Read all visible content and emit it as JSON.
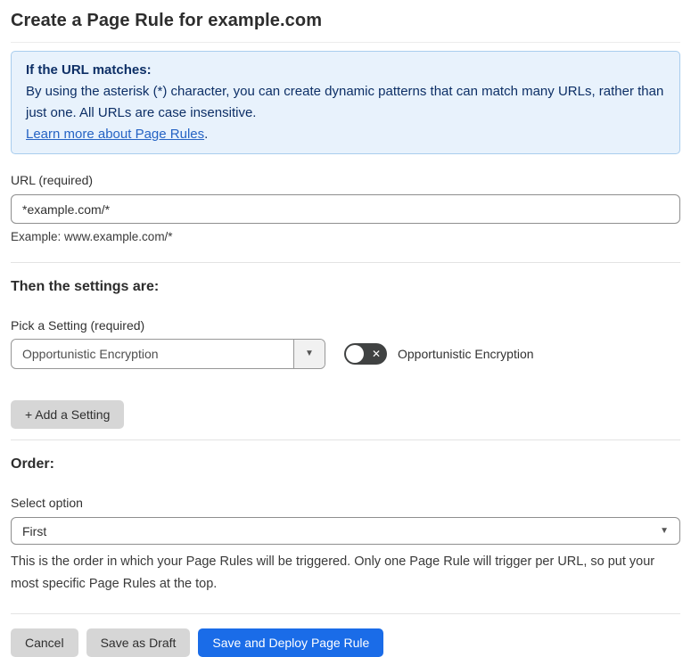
{
  "page": {
    "title": "Create a Page Rule for example.com"
  },
  "info_box": {
    "heading": "If the URL matches:",
    "body": "By using the asterisk (*) character, you can create dynamic patterns that can match many URLs, rather than just one. All URLs are case insensitive.",
    "link_label": "Learn more about Page Rules",
    "link_suffix": "."
  },
  "url_field": {
    "label": "URL (required)",
    "value": "*example.com/*",
    "helper": "Example: www.example.com/*"
  },
  "settings_section": {
    "heading": "Then the settings are:",
    "picker_label": "Pick a Setting (required)",
    "picker_value": "Opportunistic Encryption",
    "picker_arrow_icon": "▼",
    "toggle_state": "off",
    "toggle_off_glyph": "✕",
    "toggle_label": "Opportunistic Encryption",
    "add_setting_label": "+ Add a Setting"
  },
  "order_section": {
    "heading": "Order:",
    "select_label": "Select option",
    "select_value": "First",
    "select_arrow_icon": "▼",
    "helper": "This is the order in which your Page Rules will be triggered. Only one Page Rule will trigger per URL, so put your most specific Page Rules at the top."
  },
  "footer": {
    "cancel_label": "Cancel",
    "save_draft_label": "Save as Draft",
    "save_deploy_label": "Save and Deploy Page Rule"
  },
  "colors": {
    "accent_blue": "#1a6ce8",
    "info_bg": "#e8f2fc",
    "info_border": "#a9cdee",
    "info_text": "#0d2f66",
    "link_blue": "#2563c4",
    "toggle_off_bg": "#404242",
    "button_grey": "#d6d6d6"
  }
}
